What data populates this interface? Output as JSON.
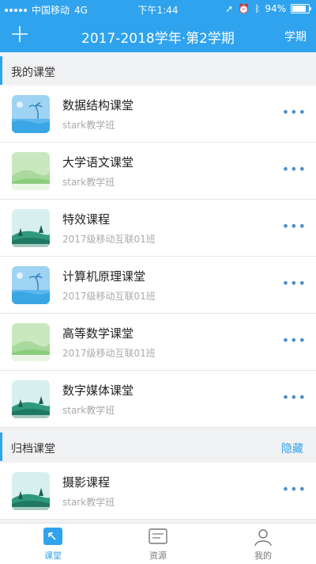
{
  "status": {
    "carrier": "中国移动",
    "network": "4G",
    "time": "下午1:44",
    "battery": "94%"
  },
  "nav": {
    "title": "2017-2018学年·第2学期",
    "term_button": "学期",
    "add_icon": "plus-icon"
  },
  "sections": {
    "mine": {
      "label": "我的课堂"
    },
    "archived": {
      "label": "归档课堂",
      "action": "隐藏"
    }
  },
  "courses": [
    {
      "name": "数据结构课堂",
      "class": "stark教学班",
      "thumb": "beach"
    },
    {
      "name": "大学语文课堂",
      "class": "stark教学班",
      "thumb": "hills"
    },
    {
      "name": "特效课程",
      "class": "2017级移动互联01班",
      "thumb": "forest"
    },
    {
      "name": "计算机原理课堂",
      "class": "2017级移动互联01班",
      "thumb": "beach"
    },
    {
      "name": "高等数学课堂",
      "class": "2017级移动互联01班",
      "thumb": "hills"
    },
    {
      "name": "数字媒体课堂",
      "class": "stark教学班",
      "thumb": "forest"
    }
  ],
  "archived_courses": [
    {
      "name": "摄影课程",
      "class": "stark教学班",
      "thumb": "forest"
    }
  ],
  "more_glyph": "•••",
  "tabs": [
    {
      "label": "课堂",
      "icon": "classroom-icon",
      "active": true
    },
    {
      "label": "资源",
      "icon": "resource-icon",
      "active": false
    },
    {
      "label": "我的",
      "icon": "profile-icon",
      "active": false
    }
  ],
  "colors": {
    "primary": "#2fa3ee",
    "more": "#4a8ec8"
  }
}
